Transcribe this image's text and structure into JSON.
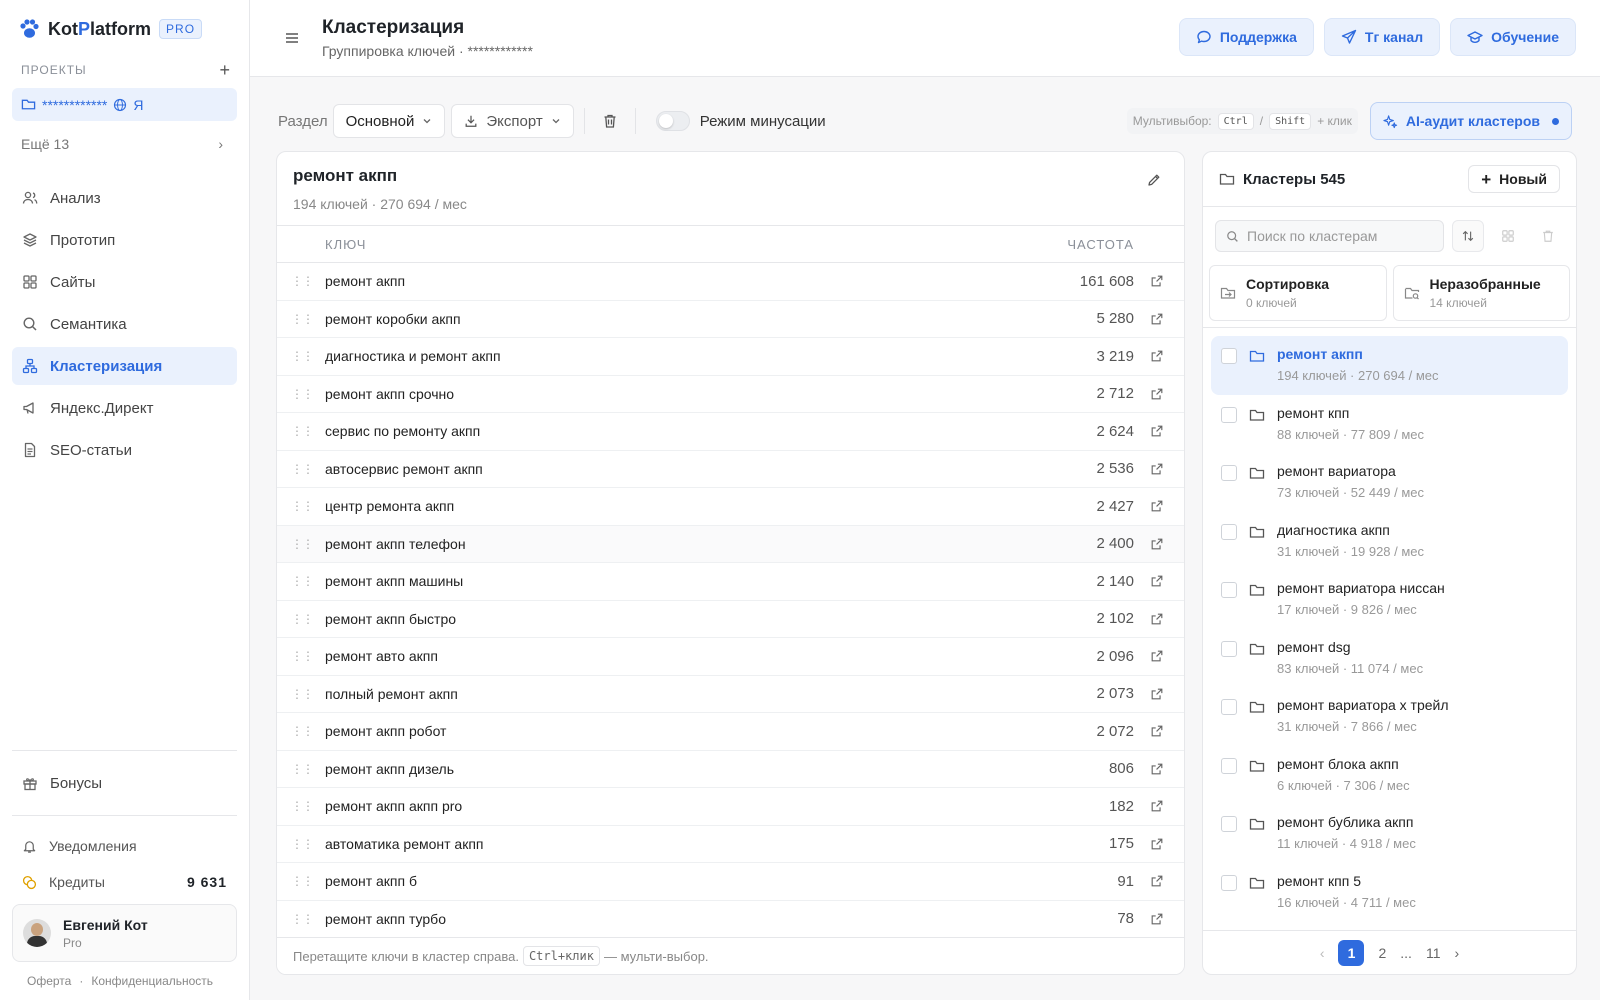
{
  "brand": {
    "name_a": "Kot",
    "name_b": "P",
    "name_c": "latform",
    "badge": "PRO"
  },
  "sidebar": {
    "projects_label": "ПРОЕКТЫ",
    "project": {
      "name": "************",
      "engine": "Я"
    },
    "more": "Ещё 13",
    "nav": [
      {
        "label": "Анализ",
        "icon": "users-icon"
      },
      {
        "label": "Прототип",
        "icon": "layers-icon"
      },
      {
        "label": "Сайты",
        "icon": "grid-icon"
      },
      {
        "label": "Семантика",
        "icon": "search-icon"
      },
      {
        "label": "Кластеризация",
        "icon": "cluster-icon",
        "active": true
      },
      {
        "label": "Яндекс.Директ",
        "icon": "megaphone-icon"
      },
      {
        "label": "SEO-статьи",
        "icon": "document-icon"
      }
    ],
    "bonus": "Бонусы",
    "notifications": "Уведомления",
    "credits": "Кредиты",
    "credits_value": "9 631",
    "user": {
      "name": "Евгений Кот",
      "plan": "Pro"
    },
    "legal": [
      "Оферта",
      "·",
      "Конфиденциальность"
    ]
  },
  "header": {
    "title": "Кластеризация",
    "subtitle": "Группировка ключей · ************",
    "actions": [
      "Поддержка",
      "Тг канал",
      "Обучение"
    ]
  },
  "toolbar": {
    "section_label": "Раздел",
    "section_value": "Основной",
    "export_label": "Экспорт",
    "minus_mode_label": "Режим минусации",
    "multiselect_label": "Мультивыбор:",
    "key_ctrl": "Ctrl",
    "key_sep": "/",
    "key_shift": "Shift",
    "plus_click": "+ клик",
    "ai_audit_label": "AI-аудит кластеров"
  },
  "cluster": {
    "title": "ремонт акпп",
    "meta": "194 ключей · 270 694 / мес",
    "col_key": "КЛЮЧ",
    "col_freq": "ЧАСТОТА",
    "rows": [
      {
        "key": "ремонт акпп",
        "freq": "161 608"
      },
      {
        "key": "ремонт коробки акпп",
        "freq": "5 280"
      },
      {
        "key": "диагностика и ремонт акпп",
        "freq": "3 219"
      },
      {
        "key": "ремонт акпп срочно",
        "freq": "2 712"
      },
      {
        "key": "сервис по ремонту акпп",
        "freq": "2 624"
      },
      {
        "key": "автосервис ремонт акпп",
        "freq": "2 536"
      },
      {
        "key": "центр ремонта акпп",
        "freq": "2 427"
      },
      {
        "key": "ремонт акпп телефон",
        "freq": "2 400"
      },
      {
        "key": "ремонт акпп машины",
        "freq": "2 140"
      },
      {
        "key": "ремонт акпп быстро",
        "freq": "2 102"
      },
      {
        "key": "ремонт авто акпп",
        "freq": "2 096"
      },
      {
        "key": "полный ремонт акпп",
        "freq": "2 073"
      },
      {
        "key": "ремонт акпп робот",
        "freq": "2 072"
      },
      {
        "key": "ремонт акпп дизель",
        "freq": "806"
      },
      {
        "key": "ремонт акпп акпп pro",
        "freq": "182"
      },
      {
        "key": "автоматика ремонт акпп",
        "freq": "175"
      },
      {
        "key": "ремонт акпп б",
        "freq": "91"
      },
      {
        "key": "ремонт акпп турбо",
        "freq": "78"
      }
    ],
    "footer_a": "Перетащите ключи в кластер справа.",
    "footer_kbd": "Ctrl+клик",
    "footer_b": "— мульти-выбор."
  },
  "clusters_panel": {
    "title": "Кластеры 545",
    "new_label": "Новый",
    "search_placeholder": "Поиск по кластерам",
    "special": [
      {
        "name": "Сортировка",
        "count": "0 ключей"
      },
      {
        "name": "Неразобранные",
        "count": "14 ключей"
      }
    ],
    "items": [
      {
        "name": "ремонт акпп",
        "meta": "194 ключей · 270 694 / мес",
        "active": true
      },
      {
        "name": "ремонт кпп",
        "meta": "88 ключей · 77 809 / мес"
      },
      {
        "name": "ремонт вариатора",
        "meta": "73 ключей · 52 449 / мес"
      },
      {
        "name": "диагностика акпп",
        "meta": "31 ключей · 19 928 / мес"
      },
      {
        "name": "ремонт вариатора ниссан",
        "meta": "17 ключей · 9 826 / мес"
      },
      {
        "name": "ремонт dsg",
        "meta": "83 ключей · 11 074 / мес"
      },
      {
        "name": "ремонт вариатора х трейл",
        "meta": "31 ключей · 7 866 / мес"
      },
      {
        "name": "ремонт блока акпп",
        "meta": "6 ключей · 7 306 / мес"
      },
      {
        "name": "ремонт бублика акпп",
        "meta": "11 ключей · 4 918 / мес"
      },
      {
        "name": "ремонт кпп 5",
        "meta": "16 ключей · 4 711 / мес"
      }
    ],
    "pager": {
      "current": "1",
      "next": "2",
      "ellipsis": "...",
      "last": "11"
    }
  },
  "colors": {
    "accent": "#2f6bde",
    "accent_bg": "#eaf1fd"
  }
}
